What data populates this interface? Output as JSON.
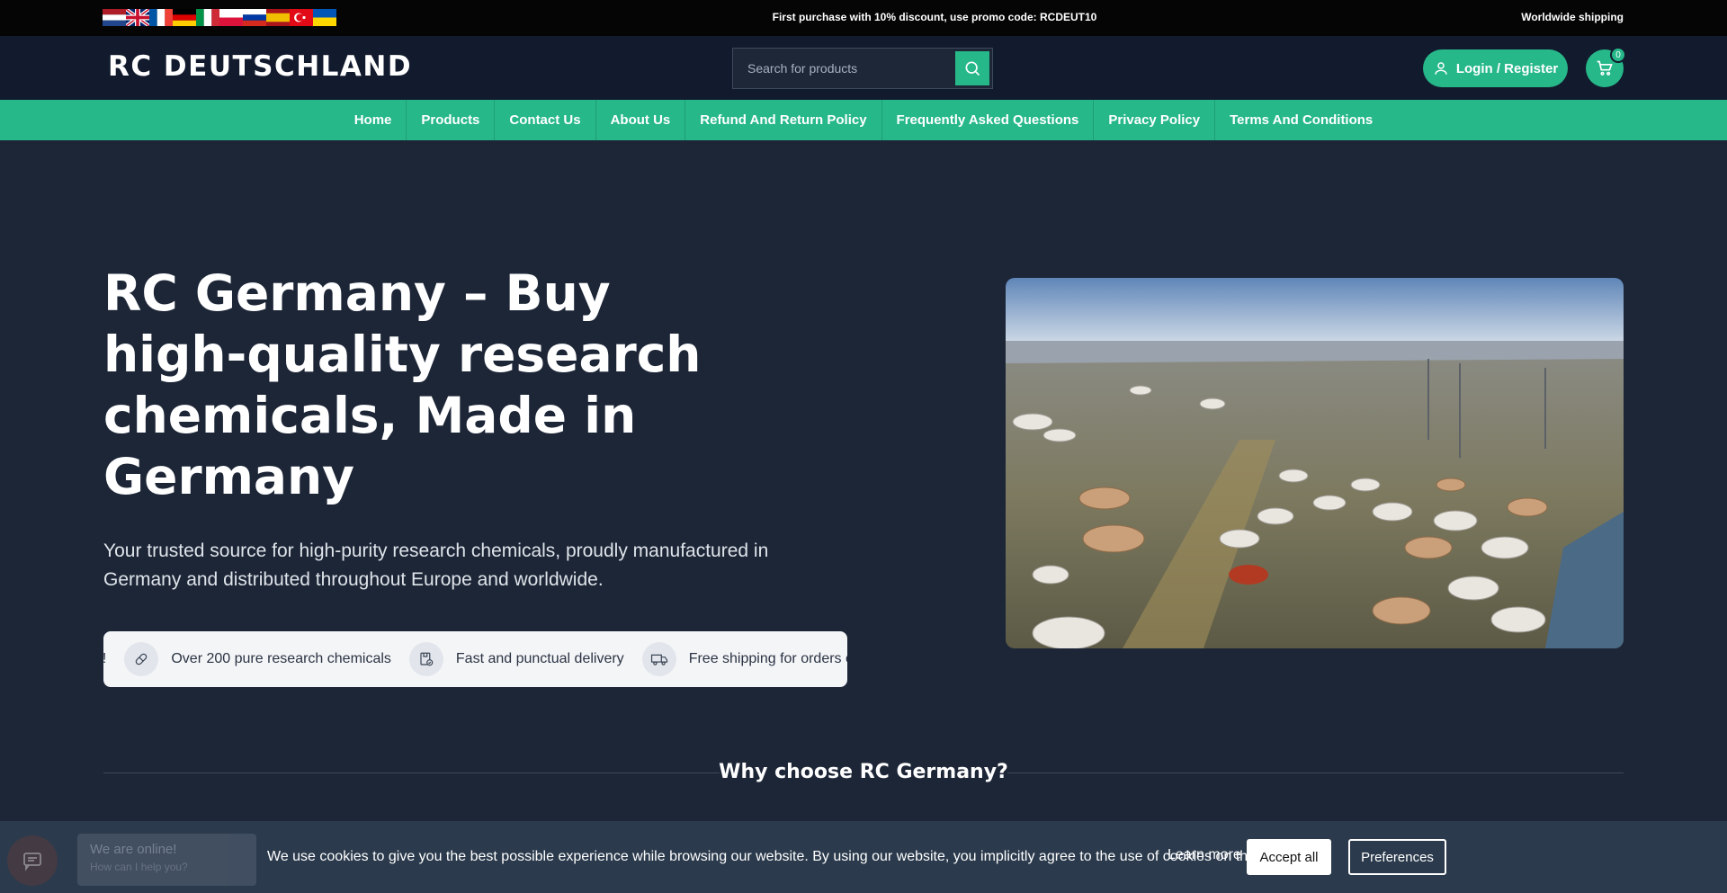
{
  "topbar": {
    "flags": [
      "nl",
      "gb",
      "fr",
      "de",
      "it",
      "pl",
      "ru",
      "es",
      "tr",
      "ua"
    ],
    "promo": "First purchase with 10% discount, use promo code: RCDEUT10",
    "shipping": "Worldwide shipping"
  },
  "header": {
    "logo": "RC DEUTSCHLAND",
    "search_placeholder": "Search for products",
    "search_icon": "search-icon",
    "login_label": "Login / Register",
    "cart_count": "0"
  },
  "nav": {
    "items": [
      {
        "label": "Home"
      },
      {
        "label": "Products"
      },
      {
        "label": "Contact Us"
      },
      {
        "label": "About Us"
      },
      {
        "label": "Refund And Return Policy"
      },
      {
        "label": "Frequently Asked Questions"
      },
      {
        "label": "Privacy Policy"
      },
      {
        "label": "Terms And Conditions"
      }
    ]
  },
  "hero": {
    "title": "RC Germany – Buy high-quality research chemicals, Made in Germany",
    "subtitle": "Your trusted source for high-purity research chemicals, proudly manufactured in Germany and distributed throughout Europe and worldwide.",
    "features": [
      {
        "label": "€!",
        "icon": ""
      },
      {
        "label": "Over 200 pure research chemicals",
        "icon": "pill-icon"
      },
      {
        "label": "Fast and punctual delivery",
        "icon": "package-check-icon"
      },
      {
        "label": "Free shipping for orders over",
        "icon": "truck-icon"
      }
    ]
  },
  "why": {
    "title": "Why choose RC Germany?"
  },
  "cookie": {
    "message": "We use cookies to give you the best possible experience while browsing our website. By using our website, you implicitly agree to the use of cookies on this site.",
    "learn_more": "Learn more",
    "accept": "Accept all",
    "preferences": "Preferences"
  },
  "chat": {
    "status": "We are online!",
    "prompt": "How can I help you?"
  },
  "colors": {
    "accent": "#26b889",
    "background": "#1d2637",
    "header": "#121b2e",
    "topbar": "#050505"
  }
}
